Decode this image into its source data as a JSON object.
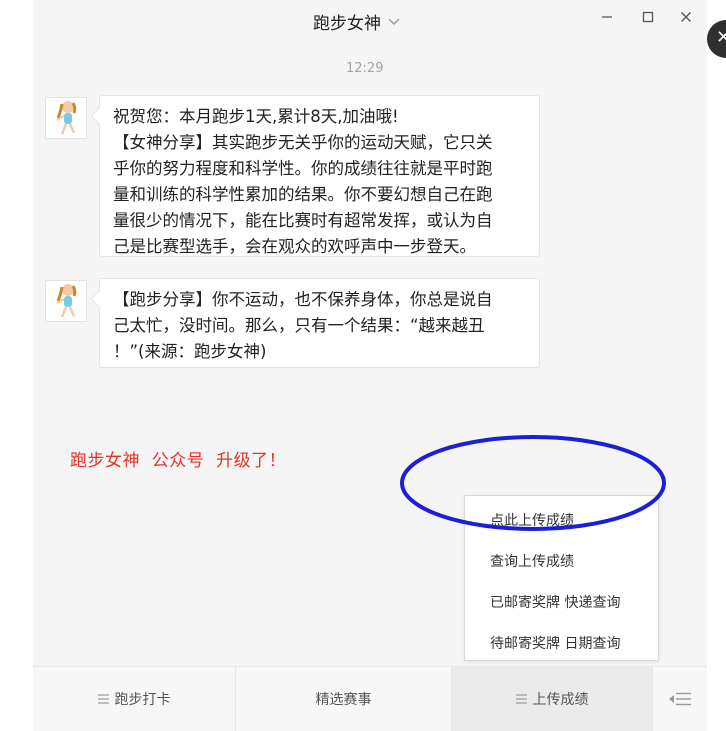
{
  "header": {
    "title": "跑步女神",
    "title_dropdown_icon": "chevron-down-icon",
    "window_controls": [
      "minimize-icon",
      "maximize-icon",
      "close-icon"
    ]
  },
  "chat": {
    "timestamp": "12:29",
    "messages": [
      {
        "sender_avatar": "runner-girl-avatar",
        "lines": [
          "祝贺您：本月跑步1天,累计8天,加油哦!",
          "【女神分享】其实跑步无关乎你的运动天赋，它只关",
          "乎你的努力程度和科学性。你的成绩往往就是平时跑",
          "量和训练的科学性累加的结果。你不要幻想自己在跑",
          "量很少的情况下，能在比赛时有超常发挥，或认为自",
          "己是比赛型选手，会在观众的欢呼声中一步登天。"
        ]
      },
      {
        "sender_avatar": "runner-girl-avatar",
        "lines": [
          "【跑步分享】你不运动，也不保养身体，你总是说自",
          "己太忙，没时间。那么，只有一个结果：“越来越丑",
          "！”(来源：跑步女神)"
        ]
      }
    ]
  },
  "annotation": {
    "note": "跑步女神  公众号  升级了！",
    "note_color": "#e53129",
    "ellipse_color": "#1d1fd6"
  },
  "popup_menu": {
    "items": [
      "点此上传成绩",
      "查询上传成绩",
      "已邮寄奖牌 快递查询",
      "待邮寄奖牌 日期查询"
    ]
  },
  "bottom_menu": {
    "buttons": [
      {
        "label": "跑步打卡",
        "icon": "menu-lines-icon"
      },
      {
        "label": "精选赛事",
        "icon": ""
      },
      {
        "label": "上传成绩",
        "icon": "menu-lines-icon"
      }
    ],
    "keyboard_toggle_icon": "keyboard-toggle-icon"
  },
  "colors": {
    "accent_red": "#e53129",
    "annotation_blue": "#1d1fd6",
    "window_bg": "#f5f5f5"
  }
}
